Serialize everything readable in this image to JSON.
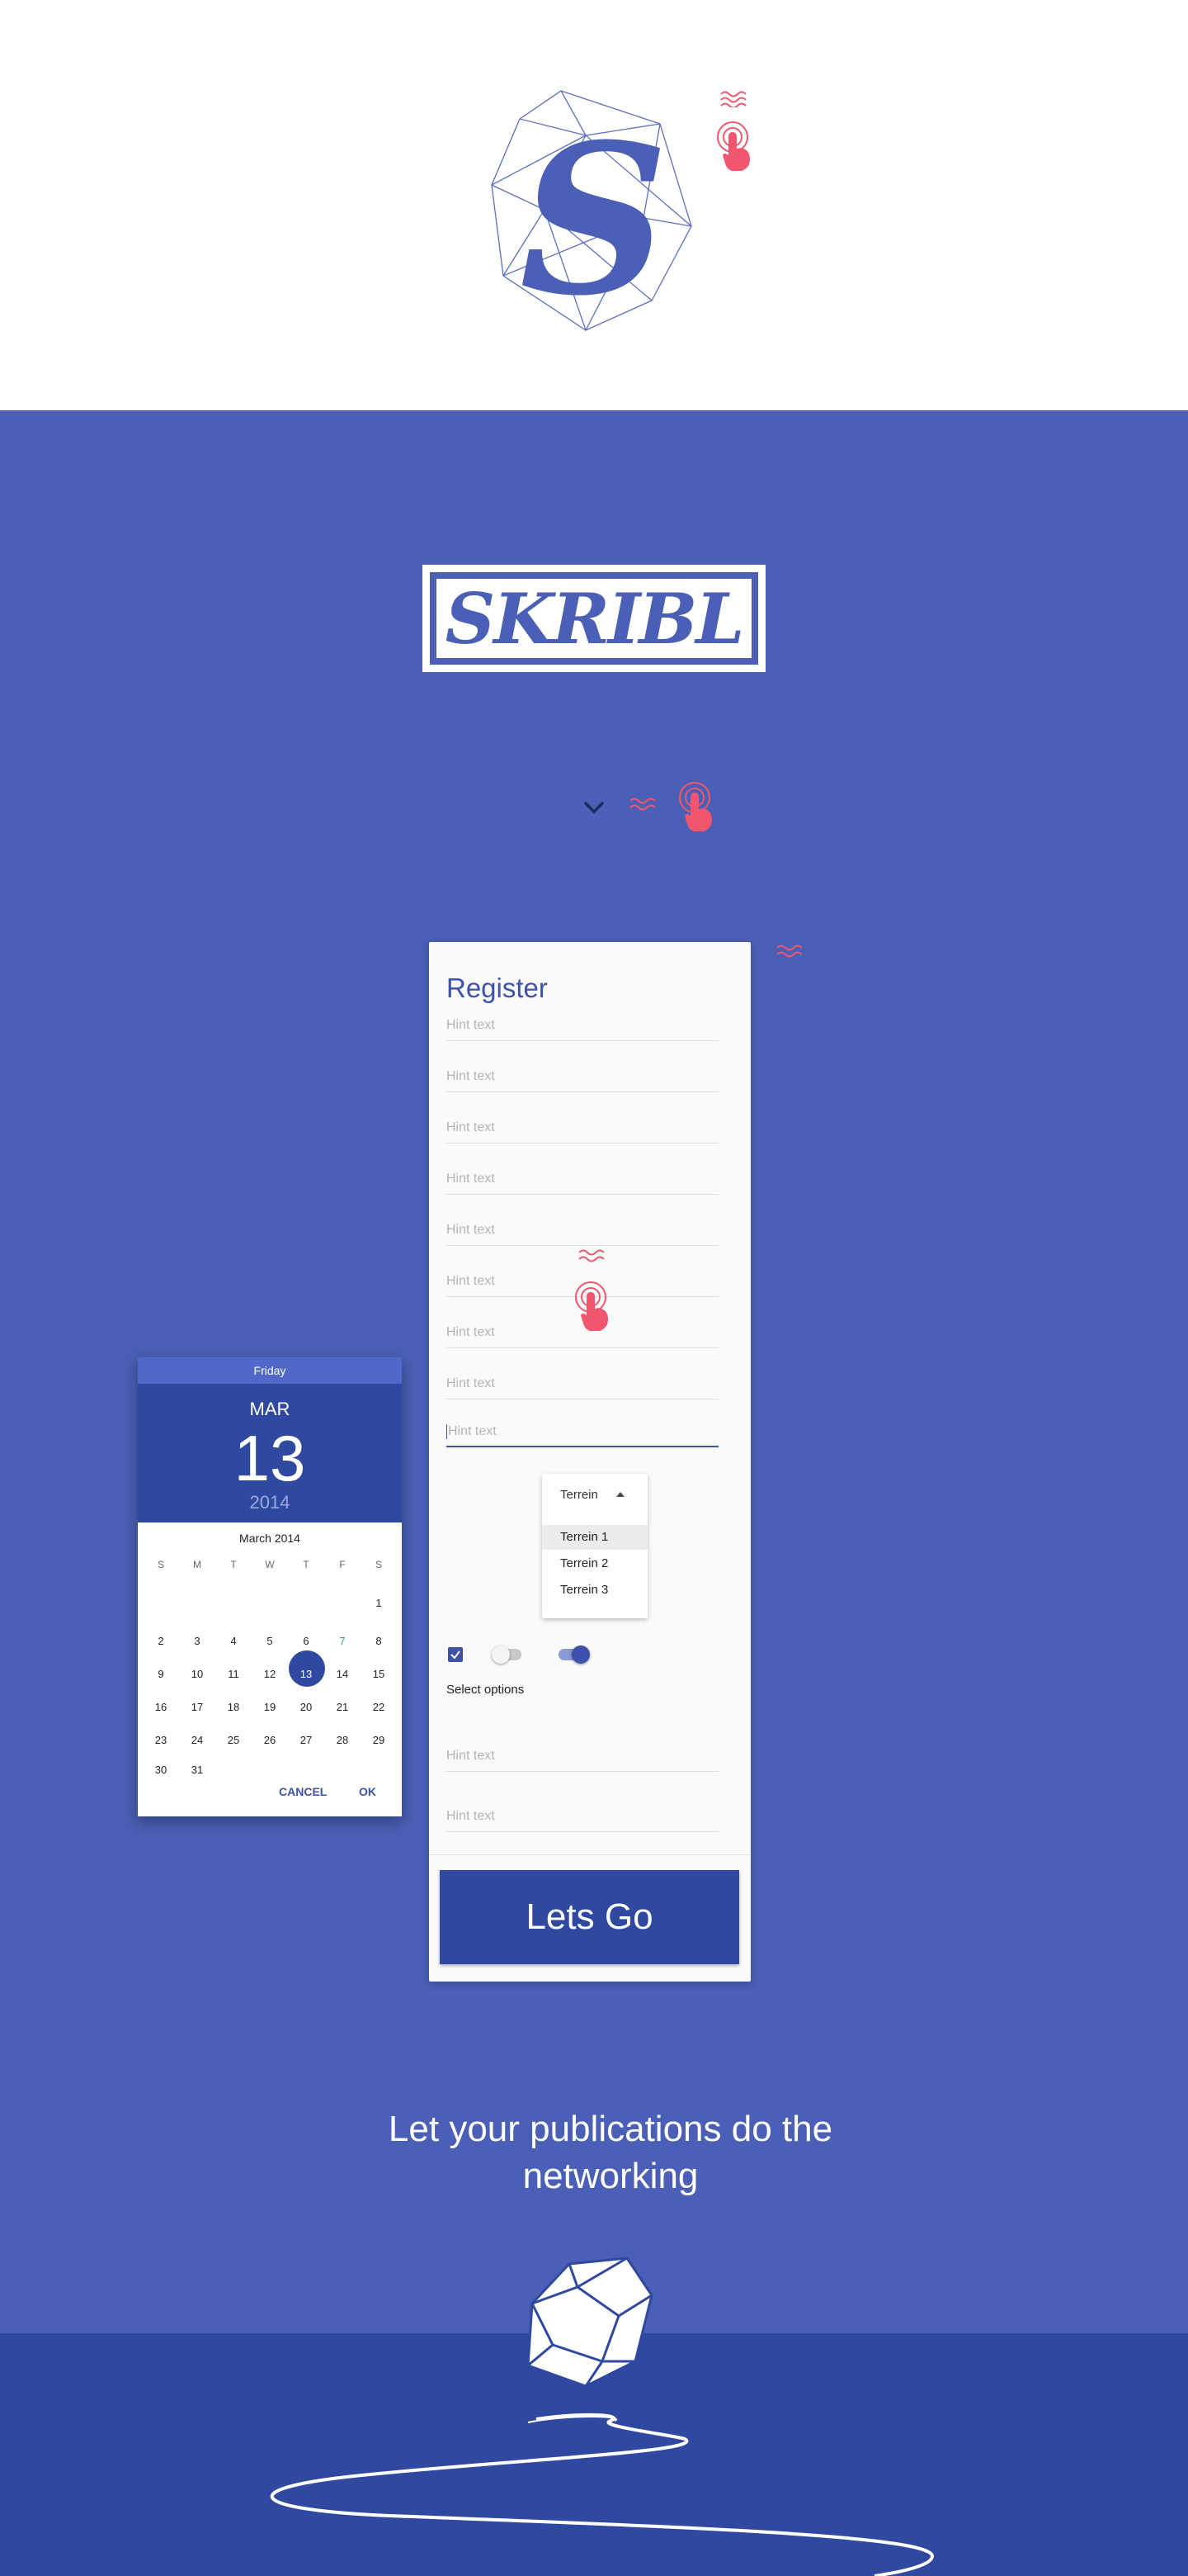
{
  "brand": {
    "logo_letter": "S",
    "wordmark": "SKRIBL"
  },
  "register": {
    "title": "Register",
    "fields": [
      "Hint text",
      "Hint text",
      "Hint text",
      "Hint text",
      "Hint text",
      "Hint text",
      "Hint text",
      "Hint text",
      "Hint text"
    ],
    "dropdown": {
      "label": "Terrein",
      "options": [
        "Terrein 1",
        "Terrein 2",
        "Terrein 3"
      ],
      "selected": "Terrein 1"
    },
    "checkbox_checked": true,
    "switch_off": false,
    "switch_on": true,
    "select_options_label": "Select options",
    "extra_fields": [
      "Hint text",
      "Hint text"
    ],
    "submit_label": "Lets Go"
  },
  "datepicker": {
    "day_name": "Friday",
    "month_short": "MAR",
    "day": "13",
    "year": "2014",
    "month_title": "March 2014",
    "weekdays": [
      "S",
      "M",
      "T",
      "W",
      "T",
      "F",
      "S"
    ],
    "weeks": [
      [
        "",
        "",
        "",
        "",
        "",
        "",
        "1"
      ],
      [
        "2",
        "3",
        "4",
        "5",
        "6",
        "7",
        "8"
      ],
      [
        "9",
        "10",
        "11",
        "12",
        "13",
        "14",
        "15"
      ],
      [
        "16",
        "17",
        "18",
        "19",
        "20",
        "21",
        "22"
      ],
      [
        "23",
        "24",
        "25",
        "26",
        "27",
        "28",
        "29"
      ],
      [
        "30",
        "31",
        "",
        "",
        "",
        "",
        ""
      ]
    ],
    "selected_day": "13",
    "highlight_day": "7",
    "cancel_label": "CANCEL",
    "ok_label": "OK"
  },
  "tagline": {
    "line1": "Let your publications do the",
    "line2": "networking"
  },
  "colors": {
    "brand_blue": "#4a5fb5",
    "dark_blue": "#2f49a1",
    "accent_red": "#f0566d"
  },
  "icons": [
    "tap-gesture-icon",
    "wave-icon",
    "chevron-down-icon",
    "check-icon",
    "gem-icon"
  ]
}
